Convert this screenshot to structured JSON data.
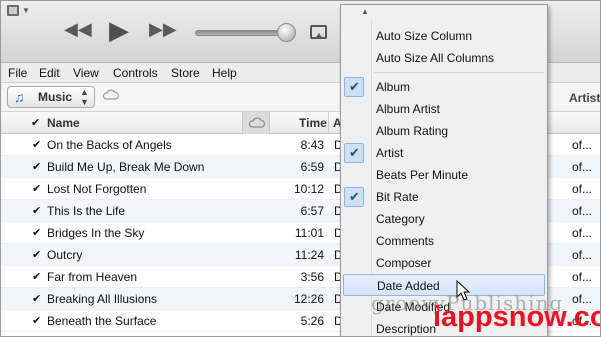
{
  "menubar": {
    "file": "File",
    "edit": "Edit",
    "view": "View",
    "controls": "Controls",
    "store": "Store",
    "help": "Help"
  },
  "sourcebar": {
    "source_label": "Music",
    "right_column_label": "Artists"
  },
  "columns": {
    "name": "Name",
    "time": "Time",
    "partial": "A"
  },
  "tracks": [
    {
      "name": "On the Backs of Angels",
      "time": "8:43",
      "date": "D",
      "artist": "of..."
    },
    {
      "name": "Build Me Up, Break Me Down",
      "time": "6:59",
      "date": "D",
      "artist": "of..."
    },
    {
      "name": "Lost Not Forgotten",
      "time": "10:12",
      "date": "D",
      "artist": "of..."
    },
    {
      "name": "This Is the Life",
      "time": "6:57",
      "date": "D",
      "artist": "of..."
    },
    {
      "name": "Bridges In the Sky",
      "time": "11:01",
      "date": "D",
      "artist": "of..."
    },
    {
      "name": "Outcry",
      "time": "11:24",
      "date": "D",
      "artist": "of..."
    },
    {
      "name": "Far from Heaven",
      "time": "3:56",
      "date": "D",
      "artist": "of..."
    },
    {
      "name": "Breaking All Illusions",
      "time": "12:26",
      "date": "D",
      "artist": "of..."
    },
    {
      "name": "Beneath the Surface",
      "time": "5:26",
      "date": "D",
      "artist": "of..."
    }
  ],
  "context_menu": {
    "auto_size_column": "Auto Size Column",
    "auto_size_all": "Auto Size All Columns",
    "items": [
      {
        "label": "Album",
        "checked": true
      },
      {
        "label": "Album Artist",
        "checked": false
      },
      {
        "label": "Album Rating",
        "checked": false
      },
      {
        "label": "Artist",
        "checked": true
      },
      {
        "label": "Beats Per Minute",
        "checked": false
      },
      {
        "label": "Bit Rate",
        "checked": true
      },
      {
        "label": "Category",
        "checked": false
      },
      {
        "label": "Comments",
        "checked": false
      },
      {
        "label": "Composer",
        "checked": false
      },
      {
        "label": "Date Added",
        "checked": false,
        "hovered": true
      },
      {
        "label": "Date Modified",
        "checked": false
      },
      {
        "label": "Description",
        "checked": false
      }
    ]
  },
  "watermark": {
    "line1": "groovyPublishing",
    "line2": "iappsnow.com"
  }
}
